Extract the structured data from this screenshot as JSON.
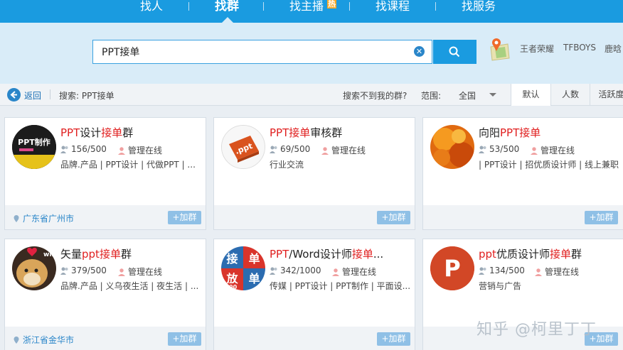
{
  "nav": {
    "items": [
      {
        "label": "找人"
      },
      {
        "label": "找群"
      },
      {
        "label": "找主播"
      },
      {
        "label": "找课程"
      },
      {
        "label": "找服务"
      }
    ],
    "hot_badge": "热"
  },
  "search": {
    "value": "PPT接单",
    "hot_keywords": [
      "王者荣耀",
      "TFBOYS",
      "鹿晗"
    ]
  },
  "filter": {
    "back_label": "返回",
    "query_label": "搜索: PPT接单",
    "not_found_label": "搜索不到我的群?",
    "range_label": "范围:",
    "range_value": "全国",
    "sort_tabs": [
      "默认",
      "人数",
      "活跃度"
    ]
  },
  "cards": [
    {
      "name_parts": [
        "PPT",
        "设计",
        "接单",
        "群"
      ],
      "members": "156/500",
      "admin": "管理在线",
      "tags": "品牌.产品 | PPT设计 | 代做PPT | ...",
      "location": "广东省广州市",
      "join": "+加群",
      "avatar_text": "PPT制作"
    },
    {
      "name_parts": [
        "PPT",
        "",
        "接单",
        "审核群"
      ],
      "members": "69/500",
      "admin": "管理在线",
      "tags": "行业交流",
      "location": "",
      "join": "+加群",
      "avatar_text": ".ppt"
    },
    {
      "name_parts": [
        "",
        "向阳",
        "PPT接单",
        ""
      ],
      "members": "53/500",
      "admin": "管理在线",
      "tags": "| PPT设计 | 招优质设计师 | 线上兼职",
      "location": "",
      "join": "+加群",
      "avatar_text": ""
    },
    {
      "name_parts": [
        "",
        "矢量",
        "ppt接单",
        "群"
      ],
      "members": "379/500",
      "admin": "管理在线",
      "tags": "品牌.产品 | 义乌夜生活 | 夜生活 | ...",
      "location": "浙江省金华市",
      "join": "+加群",
      "avatar_text": "win"
    },
    {
      "name_parts": [
        "PPT",
        "/Word设计师",
        "接单",
        "..."
      ],
      "members": "342/1000",
      "admin": "管理在线",
      "tags": "传媒 | PPT设计 | PPT制作 | 平面设...",
      "location": "",
      "join": "+加群",
      "avatar_text": "接单放单1000"
    },
    {
      "name_parts": [
        "ppt",
        "优质设计师",
        "接单",
        "群"
      ],
      "members": "134/500",
      "admin": "管理在线",
      "tags": "营销与广告",
      "location": "",
      "join": "+加群",
      "avatar_text": "P"
    }
  ],
  "watermark": "知乎 @柯里丁丁",
  "colors": {
    "accent": "#1a9be0",
    "highlight": "#e02020",
    "join": "#8fc0e6"
  }
}
